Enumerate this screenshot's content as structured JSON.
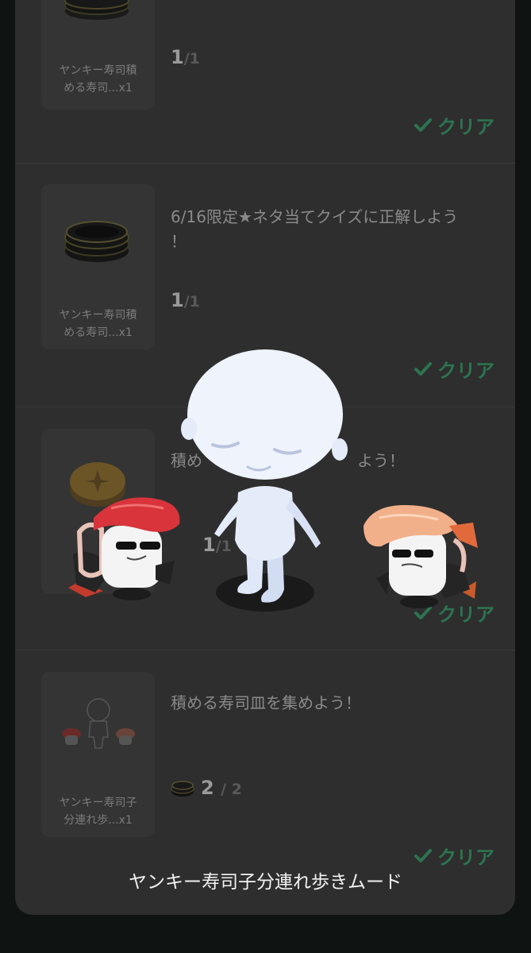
{
  "missions": [
    {
      "item_label": "ヤンキー寿司積める寿司...x1",
      "item_label_line1": "ヤンキー寿司積",
      "item_label_line2": "める寿司...x1",
      "progress_current": "1",
      "progress_total": "/1",
      "status": "クリア"
    },
    {
      "title": "6/16限定★ネタ当てクイズに正解しよう！",
      "title_line1": "6/16限定★ネタ当てクイズに正解しよう",
      "title_line2": "！",
      "item_label_line1": "ヤンキー寿司積",
      "item_label_line2": "める寿司...x1",
      "progress_current": "1",
      "progress_total": "/1",
      "status": "クリア"
    },
    {
      "title_left": "積め",
      "title_right": "よう！",
      "progress_current": "1",
      "progress_total": "/1",
      "status": "クリア"
    },
    {
      "title": "積める寿司皿を集めよう！",
      "item_label_line1": "ヤンキー寿司子",
      "item_label_line2": "分連れ歩...x1",
      "progress_current": "2",
      "progress_total": "/ 2",
      "status": "クリア"
    }
  ],
  "overlay": {
    "caption": "ヤンキー寿司子分連れ歩きムード"
  },
  "colors": {
    "accent_green": "#2c7450",
    "sheet_bg": "#2e2e2e"
  }
}
